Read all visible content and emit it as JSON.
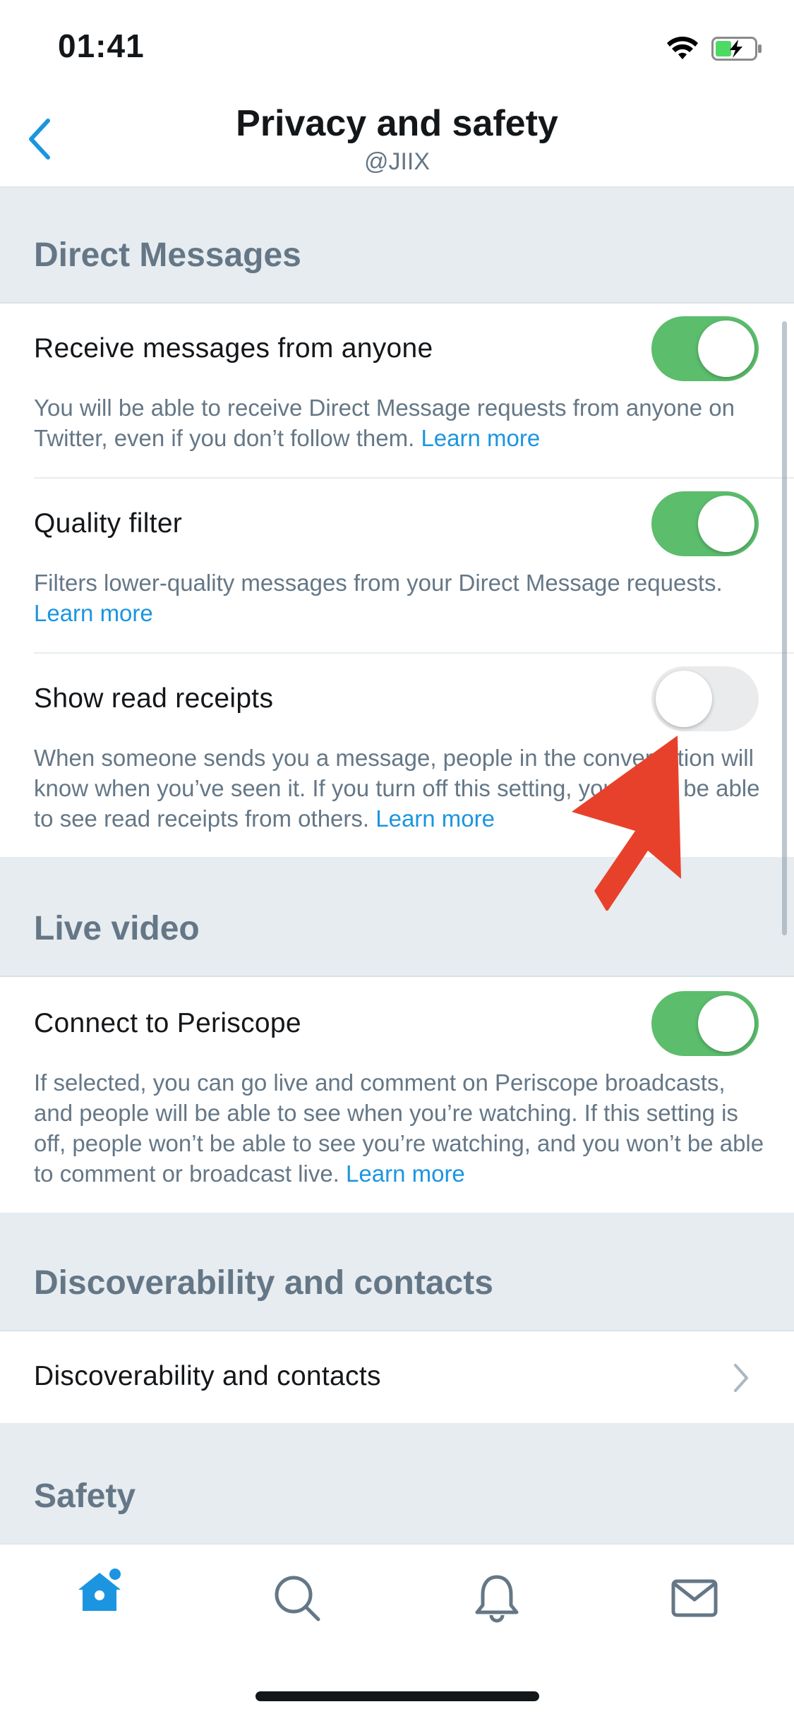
{
  "status_bar": {
    "time": "01:41"
  },
  "nav": {
    "title": "Privacy and safety",
    "subtitle": "@JIIX"
  },
  "sections": {
    "direct_messages": "Direct Messages",
    "live_video": "Live video",
    "discoverability": "Discoverability and contacts",
    "safety": "Safety"
  },
  "settings": {
    "receive_messages": {
      "title": "Receive messages from anyone",
      "desc": "You will be able to receive Direct Message requests from anyone on Twitter, even if you don’t follow them.",
      "link": "Learn more",
      "enabled": true
    },
    "quality_filter": {
      "title": "Quality filter",
      "desc": "Filters lower-quality messages from your Direct Message requests.",
      "link": "Learn more",
      "enabled": true
    },
    "read_receipts": {
      "title": "Show read receipts",
      "desc": "When someone sends you a message, people in the conversation will know when you’ve seen it. If you turn off this setting, you won’t be able to see read receipts from others.",
      "link": "Learn more",
      "enabled": false
    },
    "periscope": {
      "title": "Connect to Periscope",
      "desc": "If selected, you can go live and comment on Periscope broadcasts, and people will be able to see when you’re watching. If this setting is off, people won’t be able to see you’re watching, and you won’t be able to comment or broadcast live.",
      "link": "Learn more",
      "enabled": true
    },
    "discoverability_row": {
      "title": "Discoverability and contacts"
    }
  },
  "tabbar": {
    "items": [
      "home-icon",
      "search-icon",
      "notifications-icon",
      "messages-icon"
    ],
    "active": "home-icon"
  },
  "colors": {
    "accent": "#1b95e0",
    "toggle_on": "#5cbd6d",
    "section_bg": "#e6ecf0",
    "secondary_text": "#657786",
    "annotation_arrow": "#e8412b"
  }
}
